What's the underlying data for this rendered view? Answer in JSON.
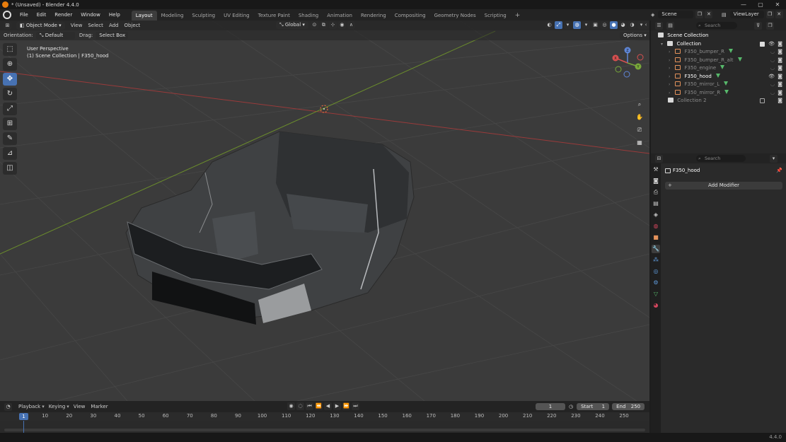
{
  "app": {
    "window_title": "* (Unsaved) - Blender 4.4.0",
    "version": "4.4.0"
  },
  "menu": [
    "File",
    "Edit",
    "Render",
    "Window",
    "Help"
  ],
  "workspaces": [
    {
      "label": "Layout",
      "active": true
    },
    {
      "label": "Modeling",
      "active": false
    },
    {
      "label": "Sculpting",
      "active": false
    },
    {
      "label": "UV Editing",
      "active": false
    },
    {
      "label": "Texture Paint",
      "active": false
    },
    {
      "label": "Shading",
      "active": false
    },
    {
      "label": "Animation",
      "active": false
    },
    {
      "label": "Rendering",
      "active": false
    },
    {
      "label": "Compositing",
      "active": false
    },
    {
      "label": "Geometry Nodes",
      "active": false
    },
    {
      "label": "Scripting",
      "active": false
    }
  ],
  "add_workspace": "+",
  "scene": {
    "label": "Scene",
    "view_layer": "ViewLayer"
  },
  "viewport_header": {
    "mode": "Object Mode",
    "menus": [
      "View",
      "Select",
      "Add",
      "Object"
    ],
    "transform_orientation": "Global",
    "options": "Options"
  },
  "tool_settings": {
    "orientation_label": "Orientation:",
    "orientation_value": "Default",
    "drag_label": "Drag:",
    "drag_value": "Select Box"
  },
  "viewport_overlay": {
    "perspective": "User Perspective",
    "context": "(1) Scene Collection | F350_hood"
  },
  "gizmo_axes": {
    "x": "X",
    "y": "Y",
    "z": "Z"
  },
  "outliner": {
    "search_placeholder": "Search",
    "root": "Scene Collection",
    "collection": "Collection",
    "objects": [
      {
        "name": "F350_bumper_R",
        "selected": false
      },
      {
        "name": "F350_bumper_R_alt",
        "selected": false
      },
      {
        "name": "F350_engine",
        "selected": false
      },
      {
        "name": "F350_hood",
        "selected": true
      },
      {
        "name": "F350_mirror_L",
        "selected": false
      },
      {
        "name": "F350_mirror_R",
        "selected": false
      }
    ],
    "collection2": "Collection 2"
  },
  "properties": {
    "search_placeholder": "Search",
    "object_name": "F350_hood",
    "add_modifier": "Add Modifier"
  },
  "timeline": {
    "menus": [
      "Playback",
      "Keying",
      "View",
      "Marker"
    ],
    "current_frame": "1",
    "start_label": "Start",
    "start_value": "1",
    "end_label": "End",
    "end_value": "250",
    "ruler": [
      "10",
      "20",
      "30",
      "40",
      "50",
      "60",
      "70",
      "80",
      "90",
      "100",
      "110",
      "120",
      "130",
      "140",
      "150",
      "160",
      "170",
      "180",
      "190",
      "200",
      "210",
      "220",
      "230",
      "240",
      "250"
    ]
  },
  "colors": {
    "accent": "#4772b3",
    "x_axis": "#c94a4a",
    "y_axis": "#7fa035",
    "object_icon": "#e4925b",
    "mesh_icon": "#57b96b"
  }
}
